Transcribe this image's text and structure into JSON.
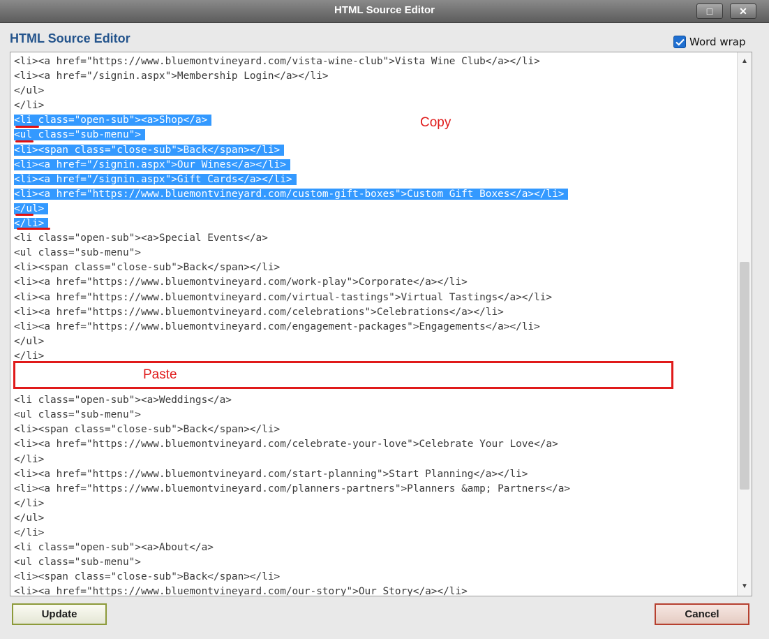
{
  "window": {
    "title": "HTML Source Editor",
    "maximize_glyph": "□",
    "close_glyph": "✕"
  },
  "header": {
    "heading": "HTML Source Editor",
    "word_wrap_label": "Word wrap",
    "word_wrap_checked": true
  },
  "annotations": {
    "copy_label": "Copy",
    "paste_label": "Paste",
    "color": "#e01a1a"
  },
  "editor": {
    "selection_color": "#3399ff",
    "lines": [
      {
        "text": "<li><a href=\"https://www.bluemontvineyard.com/vista-wine-club\">Vista Wine Club</a></li>",
        "selected": false
      },
      {
        "text": "<li><a href=\"/signin.aspx\">Membership Login</a></li>",
        "selected": false
      },
      {
        "text": "</ul>",
        "selected": false
      },
      {
        "text": "</li>",
        "selected": false
      },
      {
        "text": "<li class=\"open-sub\"><a>Shop</a>",
        "selected": true
      },
      {
        "text": "<ul class=\"sub-menu\">",
        "selected": true
      },
      {
        "text": "<li><span class=\"close-sub\">Back</span></li>",
        "selected": true
      },
      {
        "text": "<li><a href=\"/signin.aspx\">Our Wines</a></li>",
        "selected": true
      },
      {
        "text": "<li><a href=\"/signin.aspx\">Gift Cards</a></li>",
        "selected": true
      },
      {
        "text": "<li><a href=\"https://www.bluemontvineyard.com/custom-gift-boxes\">Custom Gift Boxes</a></li>",
        "selected": true
      },
      {
        "text": "</ul>",
        "selected": true
      },
      {
        "text": "</li>",
        "selected": true
      },
      {
        "text": "<li class=\"open-sub\"><a>Special Events</a>",
        "selected": false
      },
      {
        "text": "<ul class=\"sub-menu\">",
        "selected": false
      },
      {
        "text": "<li><span class=\"close-sub\">Back</span></li>",
        "selected": false
      },
      {
        "text": "<li><a href=\"https://www.bluemontvineyard.com/work-play\">Corporate</a></li>",
        "selected": false
      },
      {
        "text": "<li><a href=\"https://www.bluemontvineyard.com/virtual-tastings\">Virtual Tastings</a></li>",
        "selected": false
      },
      {
        "text": "<li><a href=\"https://www.bluemontvineyard.com/celebrations\">Celebrations</a></li>",
        "selected": false
      },
      {
        "text": "<li><a href=\"https://www.bluemontvineyard.com/engagement-packages\">Engagements</a></li>",
        "selected": false
      },
      {
        "text": "</ul>",
        "selected": false
      },
      {
        "text": "</li>",
        "selected": false
      },
      {
        "text": "",
        "selected": false
      },
      {
        "text": "",
        "selected": false
      },
      {
        "text": "<li class=\"open-sub\"><a>Weddings</a>",
        "selected": false
      },
      {
        "text": "<ul class=\"sub-menu\">",
        "selected": false
      },
      {
        "text": "<li><span class=\"close-sub\">Back</span></li>",
        "selected": false
      },
      {
        "text": "<li><a href=\"https://www.bluemontvineyard.com/celebrate-your-love\">Celebrate Your Love</a>",
        "selected": false
      },
      {
        "text": "</li>",
        "selected": false
      },
      {
        "text": "<li><a href=\"https://www.bluemontvineyard.com/start-planning\">Start Planning</a></li>",
        "selected": false
      },
      {
        "text": "<li><a href=\"https://www.bluemontvineyard.com/planners-partners\">Planners &amp; Partners</a>",
        "selected": false
      },
      {
        "text": "</li>",
        "selected": false
      },
      {
        "text": "</ul>",
        "selected": false
      },
      {
        "text": "</li>",
        "selected": false
      },
      {
        "text": "<li class=\"open-sub\"><a>About</a>",
        "selected": false
      },
      {
        "text": "<ul class=\"sub-menu\">",
        "selected": false
      },
      {
        "text": "<li><span class=\"close-sub\">Back</span></li>",
        "selected": false
      },
      {
        "text": "<li><a href=\"https://www.bluemontvineyard.com/our-story\">Our Story</a></li>",
        "selected": false
      }
    ]
  },
  "scrollbar": {
    "up_glyph": "▲",
    "down_glyph": "▼"
  },
  "buttons": {
    "update_label": "Update",
    "cancel_label": "Cancel"
  }
}
